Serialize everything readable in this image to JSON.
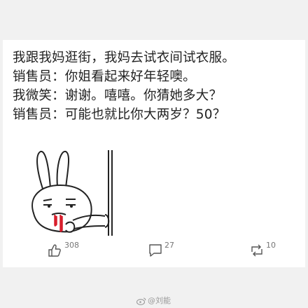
{
  "post": {
    "lines": [
      "我跟我妈逛街，我妈去试衣间试衣服。",
      "销售员：你姐看起来好年轻噢。",
      "我微笑：谢谢。嘻嘻。你猜她多大？",
      "销售员：可能也就比你大两岁？50？"
    ]
  },
  "actions": {
    "like_count": "308",
    "comment_count": "27",
    "repost_count": "10"
  },
  "watermark": {
    "text": "@刘能"
  },
  "icons": {
    "like": "thumbs-up-icon",
    "comment": "comment-bubble-icon",
    "repost": "repost-arrows-icon",
    "weibo": "weibo-logo-icon"
  }
}
